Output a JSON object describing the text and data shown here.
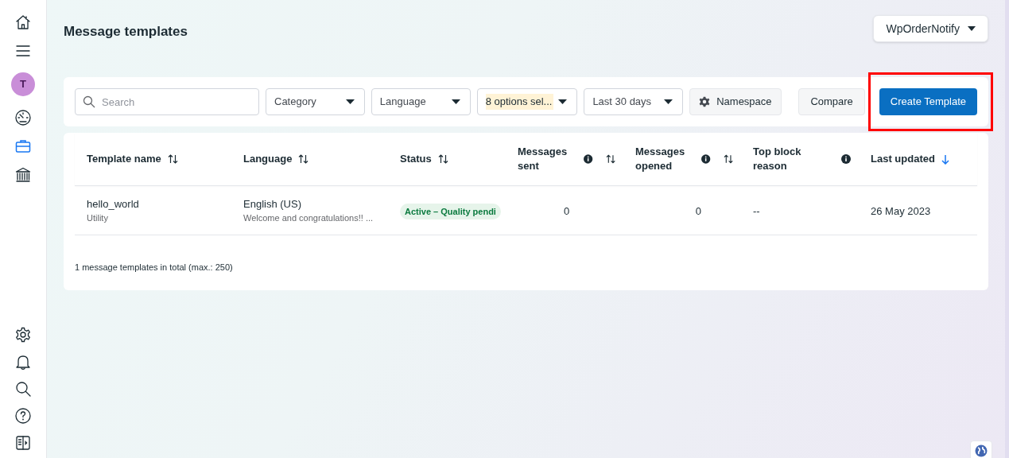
{
  "sidebar": {
    "top_items": [
      {
        "kind": "home",
        "selected": false
      },
      {
        "kind": "menu",
        "selected": false
      },
      {
        "kind": "avatar",
        "label": "T",
        "selected": false
      },
      {
        "kind": "gauge",
        "selected": false
      },
      {
        "kind": "briefcase",
        "selected": true
      },
      {
        "kind": "bank",
        "selected": false
      }
    ],
    "bottom_items": [
      {
        "kind": "settings"
      },
      {
        "kind": "bell"
      },
      {
        "kind": "search"
      },
      {
        "kind": "help"
      },
      {
        "kind": "panel"
      }
    ]
  },
  "header": {
    "title": "Message templates",
    "account": "WpOrderNotify"
  },
  "filters": {
    "search": {
      "placeholder": "Search"
    },
    "dropdowns": [
      {
        "label": "Category",
        "highlighted": false
      },
      {
        "label": "Language",
        "highlighted": false
      },
      {
        "label": "8 options sel...",
        "highlighted": true
      },
      {
        "label": "Last 30 days",
        "highlighted": false
      }
    ],
    "buttons": [
      {
        "label": "Namespace",
        "kind": "icon"
      },
      {
        "label": "Compare",
        "kind": "plain"
      },
      {
        "label": "Create Template",
        "kind": "primary",
        "annotated": true
      }
    ]
  },
  "table": {
    "columns": [
      {
        "label": "Template name",
        "info": false,
        "sortable": true,
        "sorted": false
      },
      {
        "label": "Language",
        "info": false,
        "sortable": true,
        "sorted": false
      },
      {
        "label": "Status",
        "info": false,
        "sortable": true,
        "sorted": false
      },
      {
        "label": "Messages sent",
        "info": true,
        "sortable": true,
        "sorted": false
      },
      {
        "label": "Messages opened",
        "info": true,
        "sortable": true,
        "sorted": false
      },
      {
        "label": "Top block reason",
        "info": true,
        "sortable": false
      },
      {
        "label": "Last updated",
        "info": false,
        "sortable": true,
        "sorted": true
      }
    ],
    "rows": [
      {
        "name": "hello_world",
        "category": "Utility",
        "language": "English (US)",
        "preview": "Welcome and congratulations!! ...",
        "status": "Active – Quality pendi",
        "sent": "0",
        "opened": "0",
        "block_reason": "--",
        "updated": "26 May 2023"
      }
    ]
  },
  "footer": "1 message templates in total (max.: 250)"
}
